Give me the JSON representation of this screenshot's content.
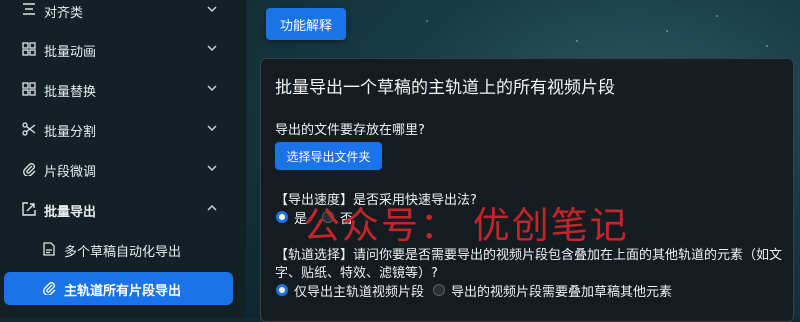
{
  "sidebar": {
    "items": [
      {
        "label": "对齐类",
        "icon": "align-icon"
      },
      {
        "label": "批量动画",
        "icon": "grid-icon"
      },
      {
        "label": "批量替换",
        "icon": "grid-icon"
      },
      {
        "label": "批量分割",
        "icon": "scissors-icon"
      },
      {
        "label": "片段微调",
        "icon": "paperclip-icon"
      },
      {
        "label": "批量导出",
        "icon": "export-icon"
      }
    ],
    "sub_items": [
      {
        "label": "多个草稿自动化导出",
        "icon": "document-icon"
      },
      {
        "label": "主轨道所有片段导出",
        "icon": "paperclip-icon"
      }
    ]
  },
  "main": {
    "help_button": "功能解释",
    "card": {
      "title": "批量导出一个草稿的主轨道上的所有视频片段",
      "save_question": "导出的文件要存放在哪里?",
      "choose_folder_button": "选择导出文件夹",
      "speed_question": "【导出速度】是否采用快速导出法?",
      "speed_options": [
        "是",
        "否"
      ],
      "track_question_line1": "【轨道选择】请问你要是否需要导出的视频片段包含叠加在上面的其他轨道的元素（如文",
      "track_question_line2": "字、贴纸、特效、滤镜等）?",
      "track_options": [
        "仅导出主轨道视频片段",
        "导出的视频片段需要叠加草稿其他元素"
      ]
    }
  },
  "watermark": "公众号：  优创笔记",
  "colors": {
    "accent": "#1a73e8",
    "watermark": "#d8262c"
  }
}
